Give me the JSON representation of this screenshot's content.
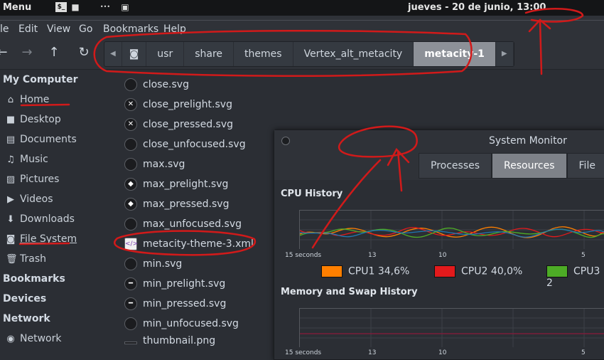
{
  "topbar": {
    "menu_label": "Menu",
    "terminal_glyph": "$_",
    "folder_glyph": "■",
    "dots_glyph": "•••",
    "window_glyph": "▣",
    "clock": "jueves - 20 de junio, 13:00"
  },
  "menubar": {
    "items": [
      "le",
      "Edit",
      "View",
      "Go",
      "Bookmarks",
      "Help"
    ]
  },
  "toolbar": {
    "back": "←",
    "forward": "→",
    "up": "↑",
    "reload": "↻"
  },
  "breadcrumb": {
    "left_arrow": "◀",
    "right_arrow": "▶",
    "root_glyph": "◙",
    "items": [
      "usr",
      "share",
      "themes",
      "Vertex_alt_metacity",
      "metacity-1"
    ]
  },
  "sidebar": {
    "headers": [
      "My Computer",
      "Bookmarks",
      "Devices",
      "Network"
    ],
    "my_computer": [
      {
        "label": "Home",
        "icon": "⌂"
      },
      {
        "label": "Desktop",
        "icon": "■"
      },
      {
        "label": "Documents",
        "icon": "▤"
      },
      {
        "label": "Music",
        "icon": "♫"
      },
      {
        "label": "Pictures",
        "icon": "▨"
      },
      {
        "label": "Videos",
        "icon": "▶"
      },
      {
        "label": "Downloads",
        "icon": "⬇"
      },
      {
        "label": "File System",
        "icon": "◙"
      },
      {
        "label": "Trash",
        "icon": "🗑"
      }
    ],
    "network": [
      {
        "label": "Network",
        "icon": "◉"
      }
    ]
  },
  "files": [
    {
      "name": "close.svg",
      "glyph": ""
    },
    {
      "name": "close_prelight.svg",
      "glyph": "✕"
    },
    {
      "name": "close_pressed.svg",
      "glyph": "✕"
    },
    {
      "name": "close_unfocused.svg",
      "glyph": ""
    },
    {
      "name": "max.svg",
      "glyph": ""
    },
    {
      "name": "max_prelight.svg",
      "glyph": "◆"
    },
    {
      "name": "max_pressed.svg",
      "glyph": "◆"
    },
    {
      "name": "max_unfocused.svg",
      "glyph": ""
    },
    {
      "name": "metacity-theme-3.xml",
      "glyph": "</>"
    },
    {
      "name": "min.svg",
      "glyph": ""
    },
    {
      "name": "min_prelight.svg",
      "glyph": "━"
    },
    {
      "name": "min_pressed.svg",
      "glyph": "━"
    },
    {
      "name": "min_unfocused.svg",
      "glyph": ""
    },
    {
      "name": "thumbnail.png",
      "glyph": ""
    }
  ],
  "sysmon": {
    "title": "System Monitor",
    "tabs": [
      "Processes",
      "Resources",
      "File System"
    ],
    "active_tab": "Resources",
    "cpu_title": "CPU History",
    "mem_title": "Memory and Swap History",
    "axis_labels": [
      "15 seconds",
      "13",
      "10",
      "5"
    ],
    "cpu_legend": [
      {
        "label": "CPU1 34,6%",
        "color": "#ff7f00"
      },
      {
        "label": "CPU2 40,0%",
        "color": "#e31a1c"
      },
      {
        "label": "CPU3 2",
        "color": "#4dac26"
      }
    ],
    "cpu4_color": "#1f78b4"
  },
  "colors": {
    "annotation": "#d11a1a",
    "accent_active": "#7e8289"
  }
}
